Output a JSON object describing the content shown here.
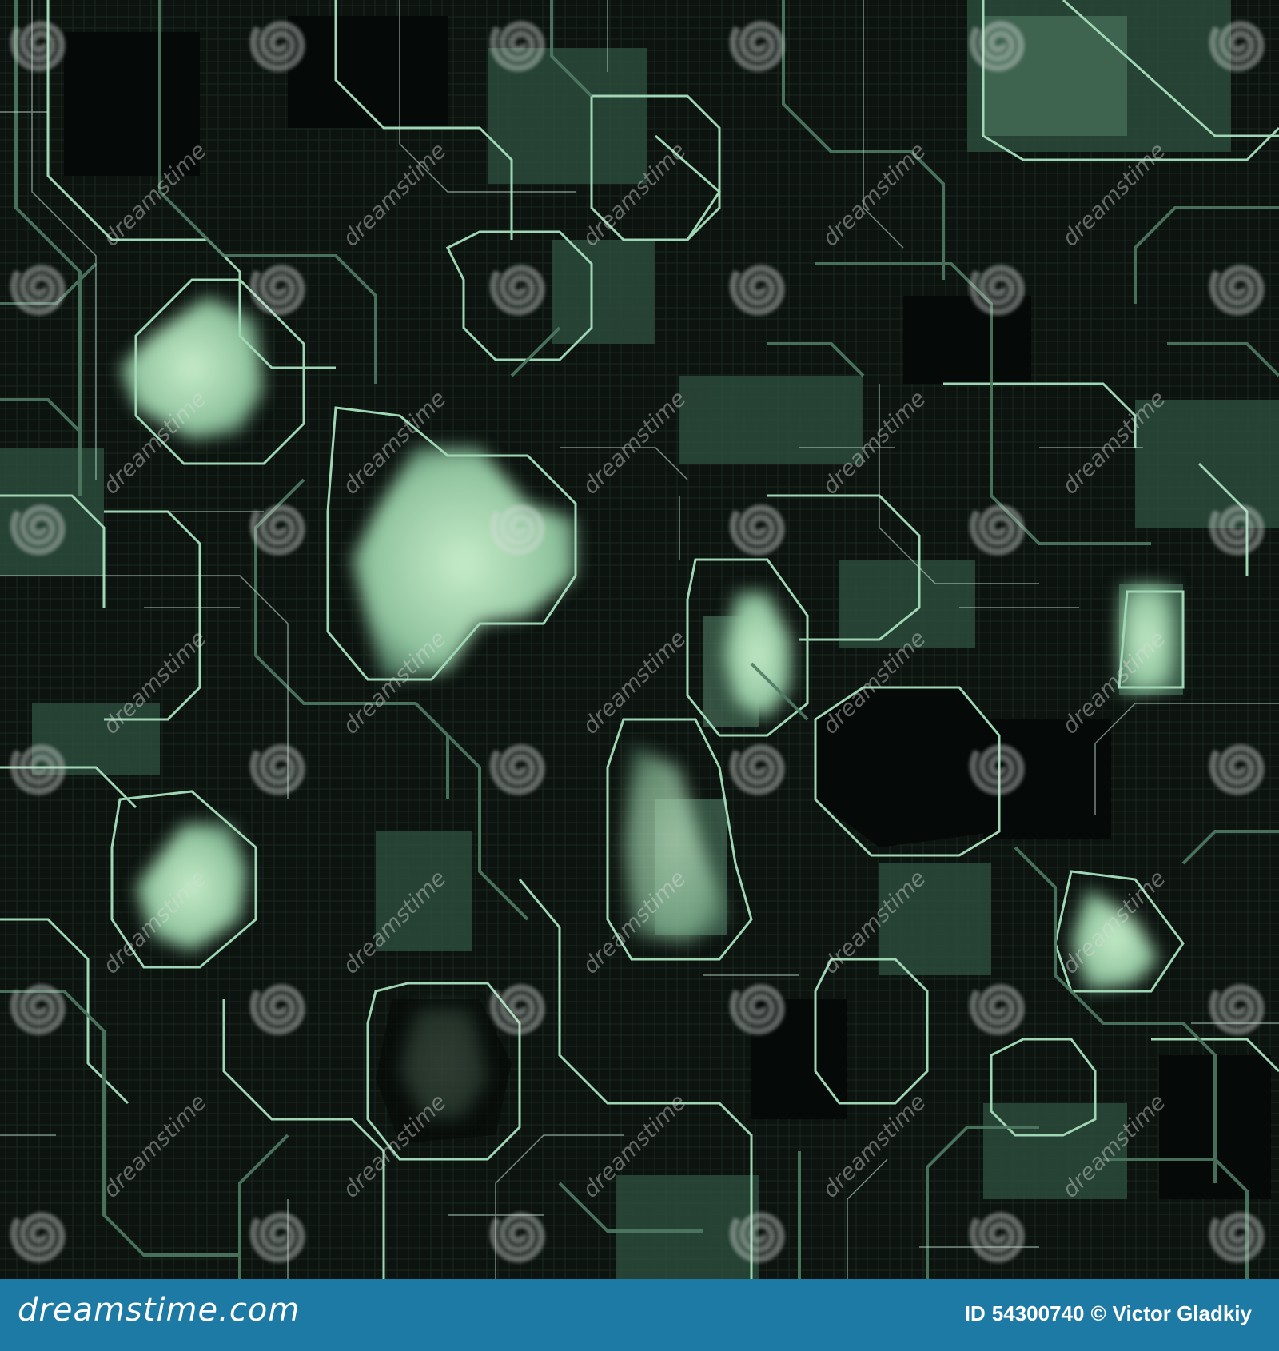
{
  "image": {
    "subject": "circuit-board-texture",
    "palette": {
      "base": "#0d1410",
      "trace": "#9fd7b4",
      "trace_dim": "#4f7a63",
      "glow": "#b8e3bd",
      "mid": "#365a48",
      "watermark": "#d8dcd9"
    }
  },
  "watermark": {
    "spiral_icon": "dreamstime-spiral-icon",
    "text": "dreamstime"
  },
  "credit_bar": {
    "background": "#1d7aa4",
    "brand": "dreamstime.com",
    "id_label": "ID",
    "id_value": "54300740",
    "copyright_symbol": "©",
    "author": "Victor Gladkiy"
  }
}
